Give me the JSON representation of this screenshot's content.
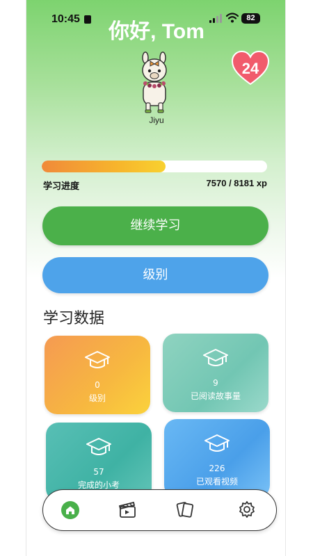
{
  "status_bar": {
    "time": "10:45",
    "battery": "82"
  },
  "header": {
    "greeting": "你好, Tom"
  },
  "mascot": {
    "name": "Jiyu",
    "icon": "alpaca-mascot"
  },
  "hearts": {
    "count": "24",
    "icon": "heart-icon",
    "color": "#f15b6c"
  },
  "progress": {
    "label": "学习进度",
    "current": 7570,
    "total": 8181,
    "value_text": "7570 / 8181 xp",
    "fraction": 0.55
  },
  "buttons": {
    "continue_label": "继续学习",
    "level_label": "级别"
  },
  "stats": {
    "title": "学习数据",
    "cards": [
      {
        "value": "0",
        "label": "级别",
        "icon": "graduation-cap-icon"
      },
      {
        "value": "9",
        "label": "已阅读故事量",
        "icon": "graduation-cap-icon"
      },
      {
        "value": "57",
        "label": "完成的小考",
        "icon": "graduation-cap-icon"
      },
      {
        "value": "226",
        "label": "已观看视频",
        "icon": "graduation-cap-icon"
      }
    ]
  },
  "nav": {
    "items": [
      {
        "icon": "home-icon",
        "active": true
      },
      {
        "icon": "clapperboard-icon",
        "active": false
      },
      {
        "icon": "flashcards-icon",
        "active": false
      },
      {
        "icon": "gear-icon",
        "active": false
      }
    ]
  },
  "colors": {
    "accent_green": "#4bb04a",
    "accent_blue": "#4ea3ea",
    "progress_orange": "#f08a3a"
  }
}
